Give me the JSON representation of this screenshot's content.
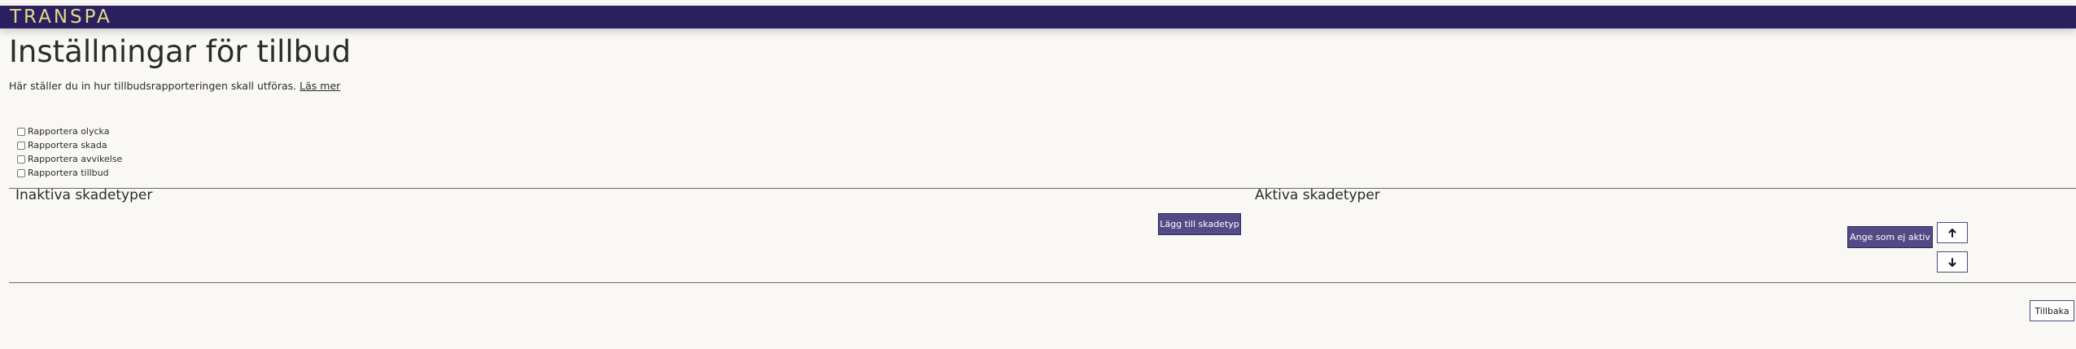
{
  "header": {
    "brand": "TRANSPA"
  },
  "page": {
    "title": "Inställningar för tillbud",
    "intro_text": "Här ställer du in hur tillbudsrapporteringen skall utföras.",
    "read_more_link": "Läs mer"
  },
  "options": [
    {
      "label": "Rapportera olycka",
      "checked": false
    },
    {
      "label": "Rapportera skada",
      "checked": false
    },
    {
      "label": "Rapportera avvikelse",
      "checked": false
    },
    {
      "label": "Rapportera tillbud",
      "checked": false
    }
  ],
  "inactive_section": {
    "title": "Inaktiva skadetyper",
    "add_button": "Lägg till skadetyp"
  },
  "active_section": {
    "title": "Aktiva skadetyper",
    "set_inactive_button": "Ange som ej aktiv",
    "move_up_icon": "arrow-up-icon",
    "move_down_icon": "arrow-down-icon"
  },
  "footer": {
    "back_button": "Tillbaka"
  },
  "colors": {
    "header_bg": "#2a2060",
    "brand_text": "#e3d98a",
    "primary_button": "#544a86",
    "page_bg": "#f9f8f5"
  }
}
